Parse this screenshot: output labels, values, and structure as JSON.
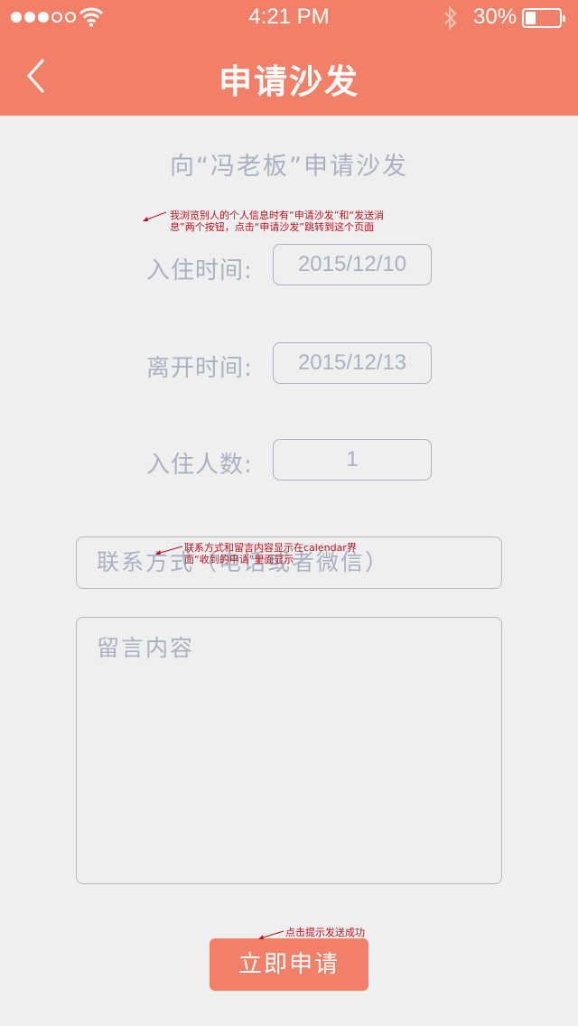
{
  "status_bar": {
    "time": "4:21 PM",
    "battery": "30%",
    "battery_level": 0.3
  },
  "nav": {
    "title": "申请沙发",
    "back_icon": "chevron-left-icon"
  },
  "subtitle": "向“冯老板”申请沙发",
  "form": {
    "checkin_label": "入住时间:",
    "checkin_value": "2015/12/10",
    "checkout_label": "离开时间:",
    "checkout_value": "2015/12/13",
    "guests_label": "入住人数:",
    "guests_value": "1",
    "contact_placeholder": "联系方式（电话或者微信）",
    "message_placeholder": "留言内容",
    "submit_label": "立即申请"
  },
  "annotations": {
    "note1": "我浏览别人的个人信息时有“申请沙发”和“发送消息”两个按钮，点击“申请沙发”跳转到这个页面",
    "note2": "联系方式和留言内容显示在calendar界面“收到的申请”里面显示",
    "note3": "点击提示发送成功"
  },
  "colors": {
    "accent": "#f28068",
    "background": "#efefef",
    "placeholder_text": "#a9b1c2",
    "annotation": "#c0101e"
  }
}
